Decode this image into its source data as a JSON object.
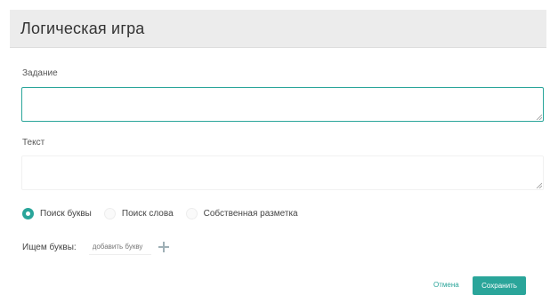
{
  "dialog": {
    "title": "Логическая игра"
  },
  "form": {
    "task_label": "Задание",
    "task_value": "",
    "text_label": "Текст",
    "text_value": "",
    "mode_options": [
      {
        "label": "Поиск буквы",
        "selected": true
      },
      {
        "label": "Поиск слова",
        "selected": false
      },
      {
        "label": "Собственная разметка",
        "selected": false
      }
    ],
    "letters_label": "Ищем буквы:",
    "letters_placeholder": "добавить букву"
  },
  "footer": {
    "cancel_label": "Отмена",
    "save_label": "Сохранить"
  },
  "colors": {
    "accent": "#2aa59a",
    "header_bg": "#ececec"
  },
  "icons": {
    "add": "plus-icon",
    "resize": "resize-grip-icon",
    "radio_on": "radio-selected-icon",
    "radio_off": "radio-unselected-icon"
  }
}
